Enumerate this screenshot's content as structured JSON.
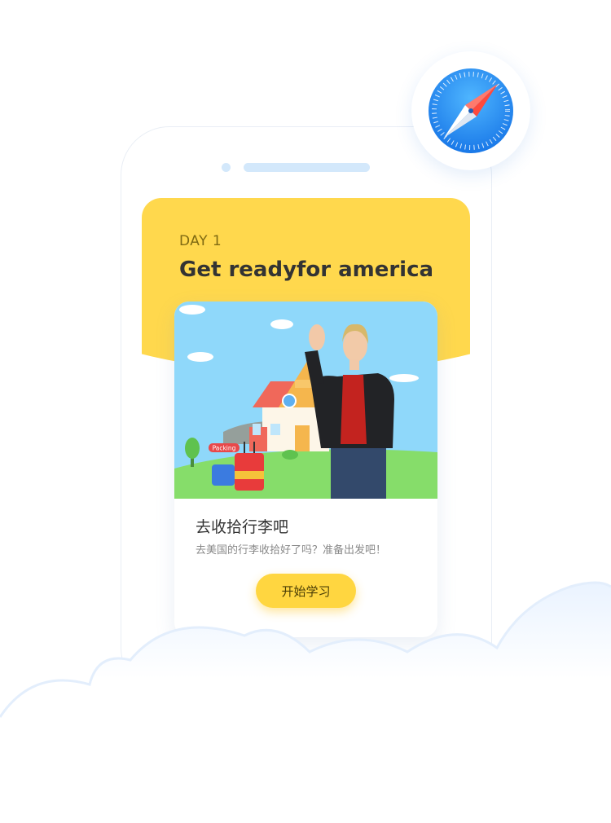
{
  "card": {
    "day": "DAY 1",
    "title": "Get readyfor america"
  },
  "illustration": {
    "sign_text": "Packing"
  },
  "lesson": {
    "title": "去收拾行李吧",
    "description": "去美国的行李收拾好了吗？准备出发吧！",
    "start_button": "开始学习"
  },
  "colors": {
    "accent_yellow": "#ffd84d",
    "safari_blue": "#1e88f0",
    "sky": "#8fd8fa",
    "grass": "#86dd6a"
  },
  "icons": [
    "safari-icon",
    "luggage-icon",
    "house-icon"
  ]
}
